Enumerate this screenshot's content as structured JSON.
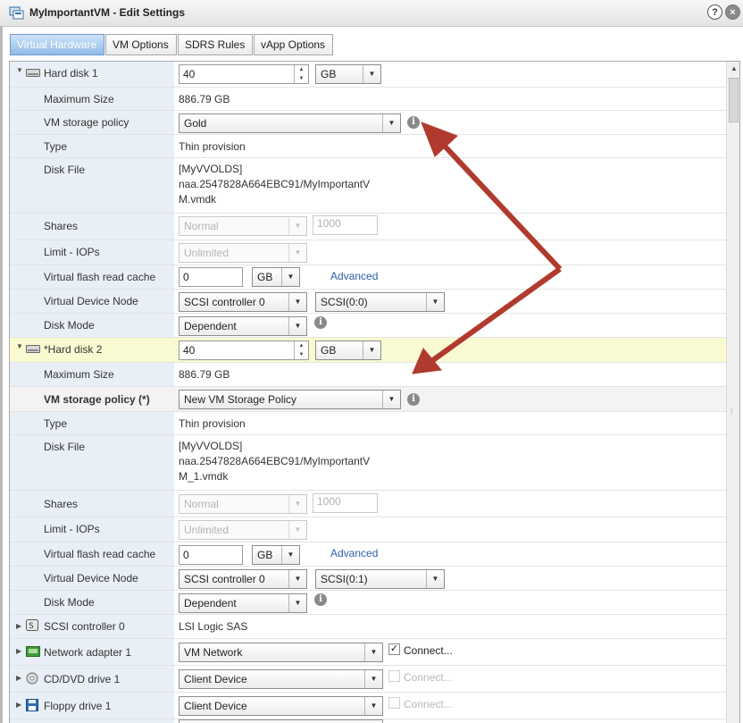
{
  "window": {
    "title": "MyImportantVM - Edit Settings",
    "help_label": "?",
    "close_label": "×"
  },
  "tabs": [
    {
      "label": "Virtual Hardware",
      "active": true
    },
    {
      "label": "VM Options"
    },
    {
      "label": "SDRS Rules"
    },
    {
      "label": "vApp Options"
    }
  ],
  "hard_disk_1": {
    "label": "Hard disk 1",
    "size_value": "40",
    "size_unit": "GB",
    "max_size_label": "Maximum Size",
    "max_size": "886.79 GB",
    "policy_label": "VM storage policy",
    "policy": "Gold",
    "type_label": "Type",
    "type": "Thin provision",
    "disk_file_label": "Disk File",
    "disk_file_line1": "[MyVVOLDS]",
    "disk_file_line2": "naa.2547828A664EBC91/MyImportantV",
    "disk_file_line3": "M.vmdk",
    "shares_label": "Shares",
    "shares": "Normal",
    "shares_value": "1000",
    "limit_label": "Limit - IOPs",
    "limit": "Unlimited",
    "flash_label": "Virtual flash read cache",
    "flash_value": "0",
    "flash_unit": "GB",
    "advanced_label": "Advanced",
    "node_label": "Virtual Device Node",
    "controller": "SCSI controller 0",
    "scsi_id": "SCSI(0:0)",
    "mode_label": "Disk Mode",
    "mode": "Dependent"
  },
  "hard_disk_2": {
    "label": "*Hard disk 2",
    "size_value": "40",
    "size_unit": "GB",
    "max_size_label": "Maximum Size",
    "max_size": "886.79 GB",
    "policy_label": "VM storage policy (*)",
    "policy": "New VM Storage Policy",
    "type_label": "Type",
    "type": "Thin provision",
    "disk_file_label": "Disk File",
    "disk_file_line1": "[MyVVOLDS]",
    "disk_file_line2": "naa.2547828A664EBC91/MyImportantV",
    "disk_file_line3": "M_1.vmdk",
    "shares_label": "Shares",
    "shares": "Normal",
    "shares_value": "1000",
    "limit_label": "Limit - IOPs",
    "limit": "Unlimited",
    "flash_label": "Virtual flash read cache",
    "flash_value": "0",
    "flash_unit": "GB",
    "advanced_label": "Advanced",
    "node_label": "Virtual Device Node",
    "controller": "SCSI controller 0",
    "scsi_id": "SCSI(0:1)",
    "mode_label": "Disk Mode",
    "mode": "Dependent"
  },
  "scsi_controller": {
    "label": "SCSI controller 0",
    "value": "LSI Logic SAS"
  },
  "network_adapter": {
    "label": "Network adapter 1",
    "value": "VM Network",
    "connect_label": "Connect...",
    "connected": true
  },
  "cd_dvd": {
    "label": "CD/DVD drive 1",
    "value": "Client Device",
    "connect_label": "Connect...",
    "connected": false
  },
  "floppy": {
    "label": "Floppy drive 1",
    "value": "Client Device",
    "connect_label": "Connect...",
    "connected": false
  },
  "icons": {
    "info": "i",
    "dropdown": "▼",
    "expanded": "▼",
    "collapsed": "▶",
    "spinner_up": "▲",
    "spinner_down": "▼"
  },
  "colors": {
    "annotation_arrow": "#b03a2e",
    "active_tab": "#8fbbe8",
    "label_column": "#e9eff6",
    "highlight_row": "#fafad2",
    "link": "#2b5ea8"
  }
}
